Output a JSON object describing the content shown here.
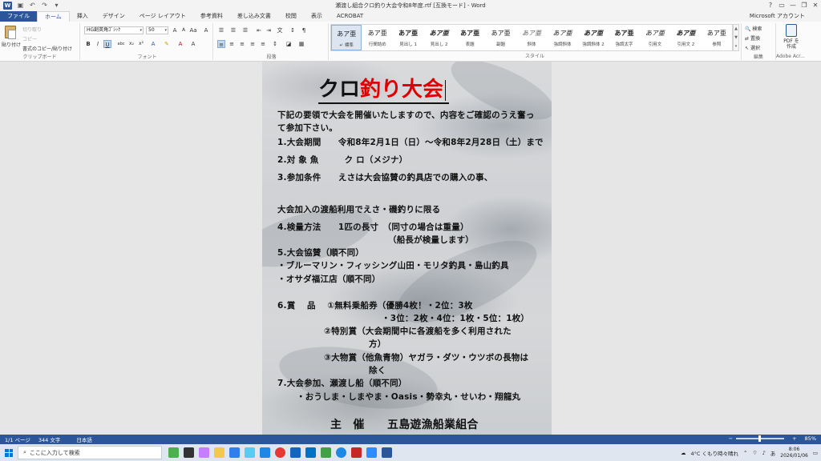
{
  "window": {
    "title": "瀬渡し組合クロ釣り大会令和8年度.rtf [互換モード] - Word",
    "controls": [
      "?",
      "▭",
      "—",
      "❐",
      "✕"
    ]
  },
  "tabs": [
    {
      "label": "ファイル"
    },
    {
      "label": "ホーム"
    },
    {
      "label": "挿入"
    },
    {
      "label": "デザイン"
    },
    {
      "label": "ページ レイアウト"
    },
    {
      "label": "参考資料"
    },
    {
      "label": "差し込み文書"
    },
    {
      "label": "校閲"
    },
    {
      "label": "表示"
    },
    {
      "label": "ACROBAT"
    }
  ],
  "account": "Microsoft アカウント",
  "ribbon": {
    "clipboard": {
      "paste": "貼り付け",
      "cut": "切り取り",
      "copy": "コピー",
      "format_painter": "書式のコピー/貼り付け",
      "label": "クリップボード"
    },
    "font": {
      "name": "HG創英角ｺﾞｼｯｸ",
      "size": "50",
      "label": "フォント"
    },
    "paragraph": {
      "label": "段落"
    },
    "styles": {
      "items": [
        {
          "sample": "あア亜",
          "name": "↵ 標準"
        },
        {
          "sample": "あア亜",
          "name": "行間詰め"
        },
        {
          "sample": "あア亜",
          "name": "見出し 1"
        },
        {
          "sample": "あア亜",
          "name": "見出し 2"
        },
        {
          "sample": "あア亜",
          "name": "表題"
        },
        {
          "sample": "あア亜",
          "name": "副題"
        },
        {
          "sample": "あア亜",
          "name": "斜体"
        },
        {
          "sample": "あア亜",
          "name": "強調斜体"
        },
        {
          "sample": "あア亜",
          "name": "強調斜体 2"
        },
        {
          "sample": "あア亜",
          "name": "強調太字"
        },
        {
          "sample": "あア亜",
          "name": "引用文"
        },
        {
          "sample": "あア亜",
          "name": "引用文 2"
        },
        {
          "sample": "あア亜",
          "name": "参照"
        }
      ],
      "label": "スタイル"
    },
    "editing": {
      "find": "検索",
      "replace": "置換",
      "select": "選択",
      "label": "編集"
    },
    "acrobat": {
      "create_pdf": "PDF を作成",
      "label": "Adobe Acr..."
    }
  },
  "document": {
    "title_black": "クロ",
    "title_red": "釣り大会",
    "title_red_color": "#e00000",
    "lines": [
      "下記の要領で大会を開催いたしますので、内容をご確認のうえ奮っ",
      "て参加下さい。",
      "1.大会期間　　令和8年2月1日（日）～令和8年2月28日（土）まで",
      "2.対 象 魚　　　ク ロ（メジナ）",
      "3.参加条件　　えさは大会協賛の釣具店での購入の事、",
      "大会加入の渡船利用でえさ・磯釣りに限る",
      "4.検量方法　　1匹の長寸　（同寸の場合は重量）",
      "（船長が検量します）",
      "5.大会協賛（順不同）",
      "・ブルーマリン・フィッシング山田・モリタ釣具・島山釣具",
      "・オサダ福江店（順不同）",
      "6.賞　 品　 ①無料乗船券（優勝4枚！・2位：3枚",
      "・3位：2枚・4位：1枚・5位：1枚）",
      "②特別賞（大会期間中に各渡船を多く利用された",
      "方）",
      "③大物賞（他魚青物）ヤガラ・ダツ・ウツボの長物は",
      "除く",
      "7.大会参加、瀬渡し船（順不同）",
      "・おうしま・しまやま・Oasis・勢幸丸・せいわ・翔龍丸",
      "主　催　　五島遊漁船業組合"
    ]
  },
  "status": {
    "page": "1/1 ページ",
    "words": "344 文字",
    "lang": "日本語",
    "zoom": "85%"
  },
  "taskbar": {
    "search_placeholder": "ここに入力して検索",
    "weather": "4°C くもり時々晴れ",
    "time": "8:06",
    "date": "2026/01/06"
  }
}
